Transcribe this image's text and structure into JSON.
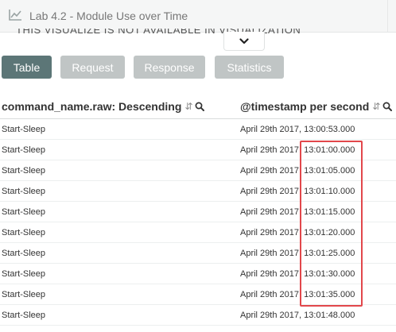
{
  "panel": {
    "title": "Lab 4.2 - Module Use over Time",
    "icon": "line-chart-icon",
    "ghost_text": "THIS VISUALIZE IS NOT AVAILABLE IN VISUALIZATION"
  },
  "collapse": {
    "icon": "chevron-down-icon"
  },
  "tabs": [
    {
      "label": "Table",
      "active": true
    },
    {
      "label": "Request",
      "active": false
    },
    {
      "label": "Response",
      "active": false
    },
    {
      "label": "Statistics",
      "active": false
    }
  ],
  "columns": {
    "command": {
      "label": "command_name.raw: Descending",
      "sort_icon": "sort-icon",
      "filter_icon": "search-icon"
    },
    "timestamp": {
      "label": "@timestamp per second",
      "sort_icon": "sort-icon",
      "filter_icon": "search-icon"
    }
  },
  "rows": [
    {
      "command": "Start-Sleep",
      "timestamp": "April 29th 2017, 13:00:53.000"
    },
    {
      "command": "Start-Sleep",
      "timestamp": "April 29th 2017, 13:01:00.000"
    },
    {
      "command": "Start-Sleep",
      "timestamp": "April 29th 2017, 13:01:05.000"
    },
    {
      "command": "Start-Sleep",
      "timestamp": "April 29th 2017, 13:01:10.000"
    },
    {
      "command": "Start-Sleep",
      "timestamp": "April 29th 2017, 13:01:15.000"
    },
    {
      "command": "Start-Sleep",
      "timestamp": "April 29th 2017, 13:01:20.000"
    },
    {
      "command": "Start-Sleep",
      "timestamp": "April 29th 2017, 13:01:25.000"
    },
    {
      "command": "Start-Sleep",
      "timestamp": "April 29th 2017, 13:01:30.000"
    },
    {
      "command": "Start-Sleep",
      "timestamp": "April 29th 2017, 13:01:35.000"
    },
    {
      "command": "Start-Sleep",
      "timestamp": "April 29th 2017, 13:01:48.000"
    }
  ],
  "colors": {
    "active_tab": "#5c7677",
    "inactive_tab": "#c0c5c5",
    "highlight": "#e2474b"
  }
}
